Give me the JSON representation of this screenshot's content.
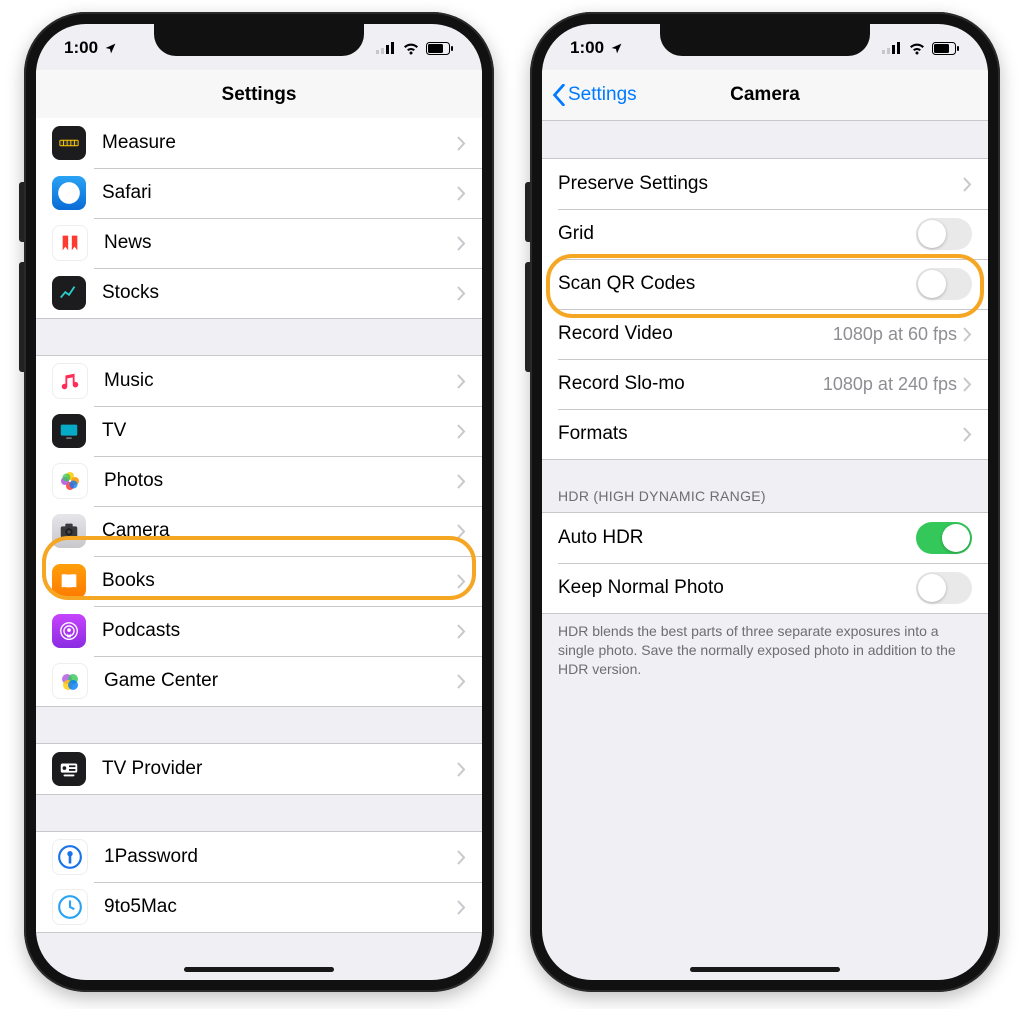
{
  "status": {
    "time": "1:00"
  },
  "left": {
    "nav_title": "Settings",
    "items": {
      "measure": "Measure",
      "safari": "Safari",
      "news": "News",
      "stocks": "Stocks",
      "music": "Music",
      "tv": "TV",
      "photos": "Photos",
      "camera": "Camera",
      "books": "Books",
      "podcasts": "Podcasts",
      "game_center": "Game Center",
      "tv_provider": "TV Provider",
      "onepassword": "1Password",
      "nine_to_five": "9to5Mac"
    }
  },
  "right": {
    "nav_back": "Settings",
    "nav_title": "Camera",
    "rows": {
      "preserve": "Preserve Settings",
      "grid": "Grid",
      "scan_qr": "Scan QR Codes",
      "record_video": "Record Video",
      "record_video_value": "1080p at 60 fps",
      "record_slomo": "Record Slo-mo",
      "record_slomo_value": "1080p at 240 fps",
      "formats": "Formats",
      "hdr_header": "HDR (HIGH DYNAMIC RANGE)",
      "auto_hdr": "Auto HDR",
      "keep_normal": "Keep Normal Photo",
      "hdr_footer": "HDR blends the best parts of three separate exposures into a single photo. Save the normally exposed photo in addition to the HDR version."
    },
    "toggles": {
      "grid": false,
      "scan_qr": false,
      "auto_hdr": true,
      "keep_normal": false
    }
  }
}
